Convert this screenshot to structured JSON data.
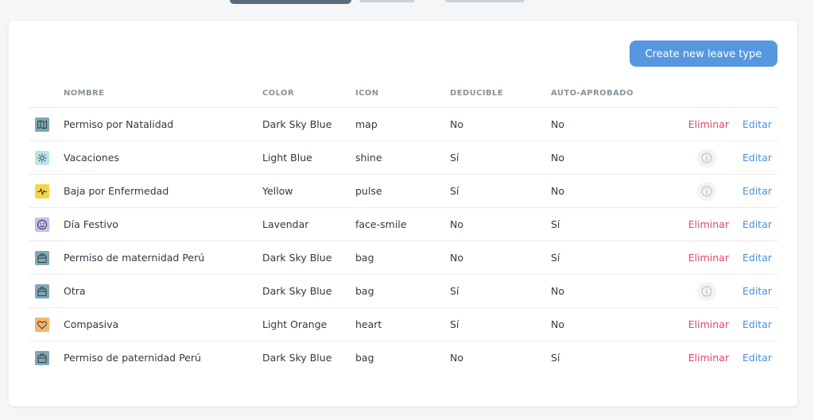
{
  "action": {
    "create_label": "Create new leave type"
  },
  "columns": {
    "name": "NOMBRE",
    "color": "COLOR",
    "icon": "ICON",
    "deductible": "DEDUCIBLE",
    "auto_approved": "AUTO-APROBADO"
  },
  "rows": [
    {
      "name": "Permiso por Natalidad",
      "color": "Dark Sky Blue",
      "icon": "map",
      "deductible": "No",
      "auto_approved": "No",
      "swatch": "#7fa8b5",
      "delete_label": "Eliminar",
      "edit_label": "Editar"
    },
    {
      "name": "Vacaciones",
      "color": "Light Blue",
      "icon": "shine",
      "deductible": "Sí",
      "auto_approved": "No",
      "swatch": "#b9e4ec",
      "edit_label": "Editar"
    },
    {
      "name": "Baja por Enfermedad",
      "color": "Yellow",
      "icon": "pulse",
      "deductible": "Sí",
      "auto_approved": "No",
      "swatch": "#f5d547",
      "edit_label": "Editar"
    },
    {
      "name": "Día Festivo",
      "color": "Lavendar",
      "icon": "face-smile",
      "deductible": "No",
      "auto_approved": "Sí",
      "swatch": "#c9b9ee",
      "delete_label": "Eliminar",
      "edit_label": "Editar"
    },
    {
      "name": "Permiso de maternidad Perú",
      "color": "Dark Sky Blue",
      "icon": "bag",
      "deductible": "No",
      "auto_approved": "Sí",
      "swatch": "#7fa8b5",
      "delete_label": "Eliminar",
      "edit_label": "Editar"
    },
    {
      "name": "Otra",
      "color": "Dark Sky Blue",
      "icon": "bag",
      "deductible": "Sí",
      "auto_approved": "No",
      "swatch": "#7fa8b5",
      "edit_label": "Editar"
    },
    {
      "name": "Compasiva",
      "color": "Light Orange",
      "icon": "heart",
      "deductible": "Sí",
      "auto_approved": "No",
      "swatch": "#f6b46c",
      "delete_label": "Eliminar",
      "edit_label": "Editar"
    },
    {
      "name": "Permiso de paternidad Perú",
      "color": "Dark Sky Blue",
      "icon": "bag",
      "deductible": "No",
      "auto_approved": "Sí",
      "swatch": "#7fa8b5",
      "delete_label": "Eliminar",
      "edit_label": "Editar"
    }
  ]
}
